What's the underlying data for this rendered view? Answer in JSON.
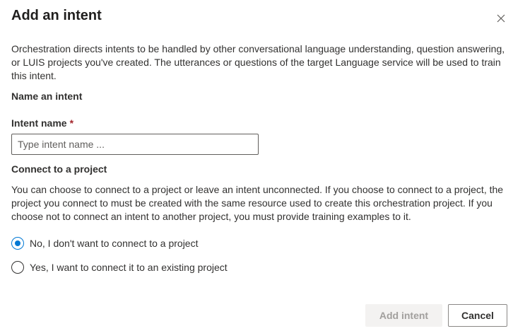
{
  "dialog": {
    "title": "Add an intent",
    "description": "Orchestration directs intents to be handled by other conversational language understanding, question answering, or LUIS projects you've created. The utterances or questions of the target Language service will be used to train this intent.",
    "close_icon": "close-icon"
  },
  "name_section": {
    "heading": "Name an intent",
    "field_label": "Intent name",
    "required_mark": "*",
    "input_value": "",
    "input_placeholder": "Type intent name ..."
  },
  "connect_section": {
    "heading": "Connect to a project",
    "description": "You can choose to connect to a project or leave an intent unconnected. If you choose to connect to a project, the project you connect to must be created with the same resource used to create this orchestration project. If you choose not to connect an intent to another project, you must provide training examples to it.",
    "options": [
      {
        "label": "No, I don't want to connect to a project",
        "selected": true
      },
      {
        "label": "Yes, I want to connect it to an existing project",
        "selected": false
      }
    ]
  },
  "footer": {
    "primary_label": "Add intent",
    "primary_disabled": true,
    "secondary_label": "Cancel"
  },
  "colors": {
    "accent": "#0078d4",
    "required": "#a4262c",
    "disabled_bg": "#f3f2f1",
    "disabled_text": "#a19f9d"
  }
}
